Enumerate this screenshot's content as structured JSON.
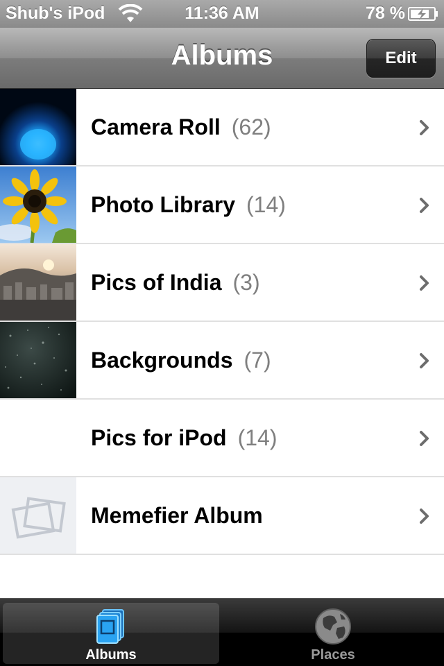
{
  "status_bar": {
    "carrier": "Shub's iPod",
    "time": "11:36 AM",
    "battery_percent": "78 %",
    "icons": [
      "wifi-icon",
      "battery-charging-icon"
    ]
  },
  "nav_bar": {
    "title": "Albums",
    "edit_label": "Edit"
  },
  "albums": [
    {
      "name": "Camera Roll",
      "count": "(62)",
      "thumbnail": "blue-light"
    },
    {
      "name": "Photo Library",
      "count": "(14)",
      "thumbnail": "sunflower"
    },
    {
      "name": "Pics of India",
      "count": "(3)",
      "thumbnail": "city-sunset"
    },
    {
      "name": "Backgrounds",
      "count": "(7)",
      "thumbnail": "dark-bokeh"
    },
    {
      "name": "Pics for iPod",
      "count": "(14)",
      "thumbnail": "none"
    },
    {
      "name": "Memefier Album",
      "count": "",
      "thumbnail": "empty-album-placeholder"
    }
  ],
  "tab_bar": {
    "tabs": [
      {
        "label": "Albums",
        "icon": "albums-icon",
        "selected": true
      },
      {
        "label": "Places",
        "icon": "globe-icon",
        "selected": false
      }
    ]
  },
  "colors": {
    "count_text": "#7f7f7f",
    "separator": "#e0e0e0",
    "selected_tab_icon": "#3aa7f0"
  }
}
